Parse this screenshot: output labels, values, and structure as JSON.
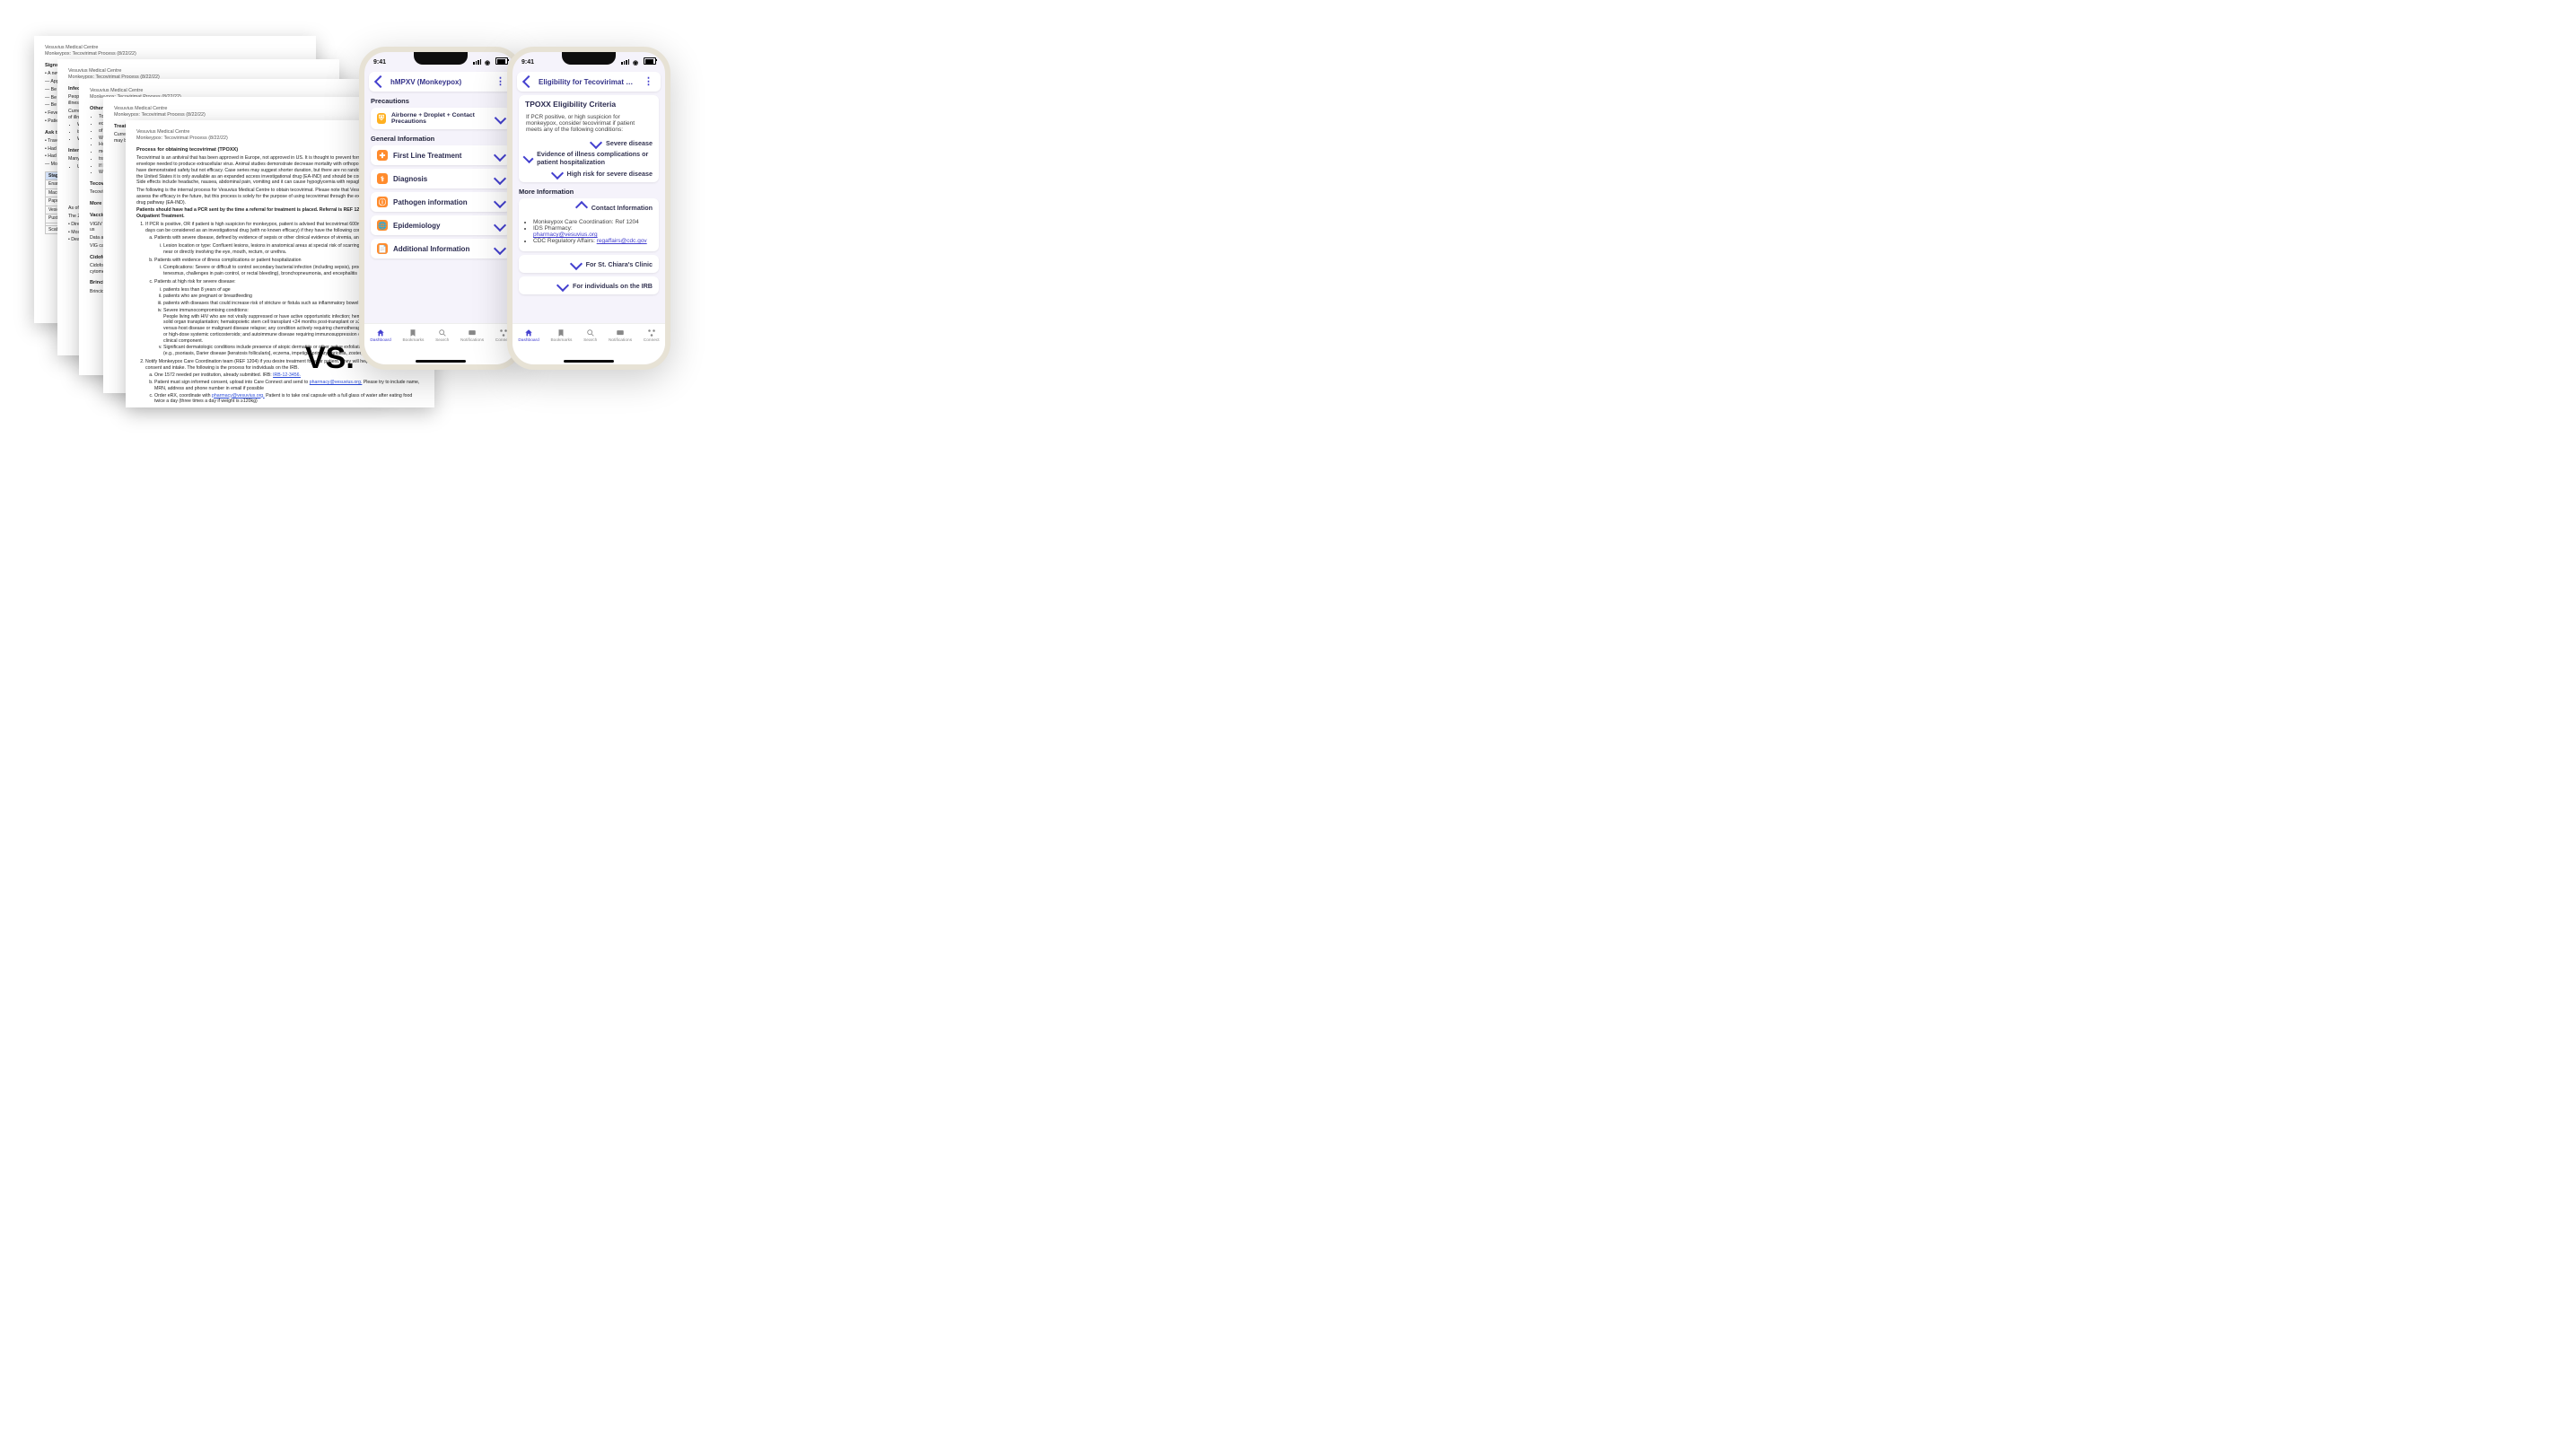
{
  "doc_header": {
    "org": "Vesuvius Medical Centre",
    "title": "Monkeypox: Tecovirimat Process (8/22/22)"
  },
  "doc1": {
    "title": "Signs and Symptoms",
    "lines": [
      "• A new, maculopapular rash that becomes well-circumscribed",
      "— Appear anywhere on the body",
      "— Be localized to a specific body region",
      "— Be the only presenting sign",
      "— Be painful, painless, or pruritic",
      "• Fever, headache, lymphadenopathy",
      "• Patients may present with symptoms such as anorectal pain, tenesmus, proctitis."
    ],
    "ask": "Ask the patient:",
    "bullets": [
      "• Traveled to",
      "• Had close contact",
      "• Had close or",
      "— Most U.S. cases with someone is common."
    ],
    "tableHeader": "Stage",
    "tableRows": [
      "Enanthem",
      "Macules",
      "Papules",
      "Vesicles",
      "Pustules",
      "",
      "Scabs"
    ]
  },
  "doc2": {
    "title": "Infection Prevention",
    "p1": "People with monkeypox should isolate at home if possible in a separate room from family members and pets, impact of this illness more from the CDC.",
    "p2": "Current data suggest people can spread monkeypox from the time symptoms start until full healing of all lesions and duration of illness isolated throu",
    "bullets": [
      "While",
      "isolat",
      "While"
    ],
    "interim": "Interim Clinical Guidance",
    "p3": "Many people in the prognosis, disease cause illnesses, and might include",
    "until": "Until",
    "bottom": [
      "As of July 15, for a long duration has not been",
      "The 2022 global outbreak",
      "• Direct exposure",
      "• Most",
      "• Deat"
    ]
  },
  "doc3": {
    "otherTitle": "Other Considerations",
    "otherBullets": [
      "To wh",
      "ecz",
      "of mo",
      "Wheth",
      "How c",
      "monke",
      "trans",
      "If Mo",
      "Wheth"
    ],
    "tecovTitle": "Tecovirimat (TPOXX)",
    "tecov": "Tecovirimat is an antiviral the treatment monkeypox is disease cause an expanded monkeypox d the capsule c",
    "moreTitle": "More details on treatment",
    "vacTitle": "Vaccinia Immune Globulin (VIGIV)",
    "vigiv": "VIGIV is licensed for the treatment of complications due to vaccinia vaccinatum, aberrant infection, allows the us",
    "vigiv2": "Data are not available on the effectiveness of VIG in the treatment with VIG. How",
    "vigiv3": "VIG can be considered for prophylactic use in an exposed person with smallpox vac",
    "cidTitle": "Cidofovir (also known as Vistide)",
    "cid": "Cidofovir is an antiviral retinitis in patients treating humans studies. CDC orthopoxvirus will benefit from improved safety of cytomegalovirus",
    "brinTitle": "Brincidofovir (also known as CMX001 or Tembexa)",
    "brin": "Brincidofovir is human small Brincidofovir"
  },
  "doc4": {
    "treatTitle": "Treatment of Monkeypox",
    "treat": "Currently there is no treatment approved specifically for monkeypox. However, patients with severe disease or at high risk may benefit from antivirals available from the Strategic National Stockpile.",
    "procTitle": "Process for obtaining tecovirimat (TPOXX)",
    "p1": "Tecovirimat is an antiviral that has been approved in Europe, not approved in US. It is thought to prevent formation of secondary viral envelope needed to produce extracellular virus. Animal studies demonstrate decrease mortality with orthopoxviruses. Studies on humans have demonstrated safety but not efficacy. Case series may suggest shorter duration, but there are no randomized control trials to date. In the United States it is only available as an expanded access investigational drug (EA-IND) and should be considered purely investigational. Side effects include headache, nausea, abdominal pain, vomiting and it can cause hypoglycemia with repaglinide.",
    "p2": "The following is the internal process for Vesuvius Medical Centre to obtain tecovirimat. Please note that Vesuvius will be a site for trials to assess the efficacy in the future, but this process is solely for the purpose of using tecovirimat through the expanded access investigational drug pathway (EA-IND).",
    "bold": "Patients should have had a PCR sent by the time a referral for treatment is placed. Referral is REF 1204, Referral for Monkeypox Outpatient Treatment.",
    "ol1": "If PCR is positive, OR if patient is high suspicion for monkeypox, patient is advised that tecovirimat 600mg po q12 (q8 if ≥120kg) x 14 days can be considered as an investigational drug (with no known efficacy) if they have the following conditions:",
    "a": "Patients with severe disease, defined by evidence of sepsis or other clinical evidence of viremia, and lesion location or type",
    "ai": "Lesion location or type: Confluent lesions, lesions in anatomical areas at special risk of scarring or stricture, such as those near or directly involving the eye, mouth, rectum, or urethra.",
    "b": "Patients with evidence of illness complications or patient hospitalization",
    "bi": "Complications: Severe or difficult to control secondary bacterial infection (including sepsis), proctitis (particularly with tenesmus, challenges in pain control, or rectal bleeding), bronchopneumonia, and encephalitis",
    "c": "Patients at high risk for severe disease:",
    "ci": "patients less than 8 years of age",
    "cii": "patients who are pregnant or breastfeeding",
    "ciii": "patients with diseases that could increase risk of stricture or fistula such as inflammatory bowel disease",
    "civ": "Severe immunocompromising conditions:",
    "civtxt": "People living with HIV who are not virally suppressed or have active opportunistic infection; hematologic malignancy; history of solid organ transplantation; hematopoietic stem cell transplant <24 months post-transplant or ≥24 months but with graft-versus-host disease or malignant disease relapse; any condition actively requiring chemotherapy, radiation, or corticosteroid or high-dose systemic corticosteroids; and autoimmune disease requiring immunosuppression or with immunodeficiency as a clinical component.",
    "cv": "Significant dermatologic conditions include presence of atopic dermatitis or other active exfoliative skin conditions or infections (e.g., psoriasis, Darier disease [keratosis follicularis], eczema, impetigo, primary varicella, zoster, or herpes).",
    "ol2": "Notify Monkeypox Care Coordination team (REF 1204) if you desire treatment for your patient. They will help schedule patient for consent and intake. The following is the process for individuals on the IRB.",
    "a2": "One 1572 needed per institution, already submitted. IRB:",
    "irbLink": "IRB-12-3456.",
    "b2": "Patient must sign informed consent, upload into Care Connect and send to",
    "b2link": "pharmacy@vesuvius.org.",
    "b2tail": "Please try to include name, MRN, address and phone number in email if possible",
    "c2": "Order eRX, coordinate with",
    "c2link": "pharmacy@vesuvius.org.",
    "c2tail": "Patient is to take oral capsule with a full glass of water after eating food twice a day (three times a day if weight is ≥120kg)"
  },
  "vs": "VS.",
  "status": {
    "time": "9:41"
  },
  "tabs": [
    "Dashboard",
    "Bookmarks",
    "Search",
    "Notifications",
    "Connect"
  ],
  "phone1": {
    "title": "hMPXV (Monkeypox)",
    "sec1": "Precautions",
    "precaution": "Airborne + Droplet + Contact Precautions",
    "sec2": "General Information",
    "cards": [
      "First Line Treatment",
      "Diagnosis",
      "Pathogen information",
      "Epidemiology",
      "Additional Information"
    ]
  },
  "phone2": {
    "title": "Eligibility for Tecovirimat …",
    "box1": "TPOXX Eligibility Criteria",
    "intro": "If PCR positive, or high suspicion for monkeypox, consider tecovirimat if patient meets any of the following conditions:",
    "drops": [
      "Severe disease",
      "Evidence of illness complications or patient hospitalization",
      "High risk for severe disease"
    ],
    "sec2": "More Information",
    "contactTitle": "Contact Information",
    "contact": [
      "Monkeypox Care Coordination: Ref 1204",
      "IDS Pharmacy:",
      "pharmacy@vesuvius.org",
      "CDC Regulatory Affairs:",
      "regaffairs@cdc.gov"
    ],
    "more": [
      "For St. Chiara's Clinic",
      "For individuals on the IRB"
    ]
  }
}
